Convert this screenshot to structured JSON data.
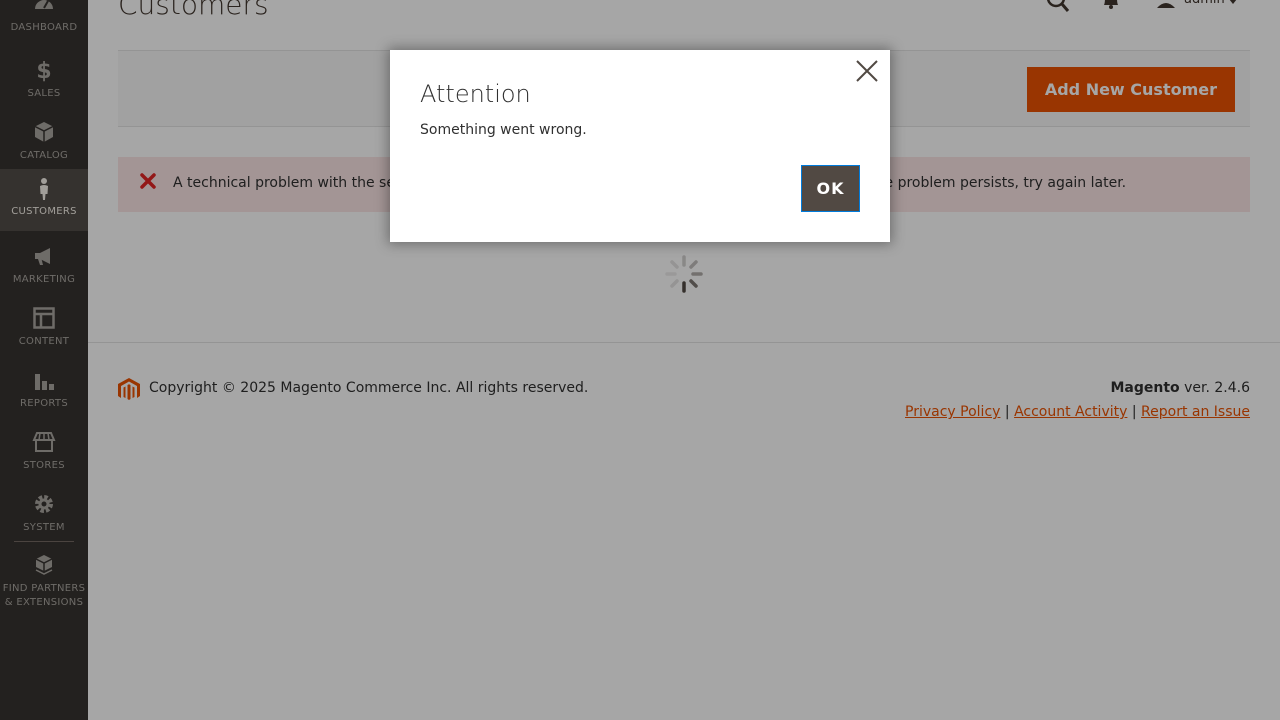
{
  "sidebar": {
    "items": [
      {
        "label": "Dashboard",
        "icon": "dashboard-icon"
      },
      {
        "label": "Sales",
        "icon": "dollar-icon"
      },
      {
        "label": "Catalog",
        "icon": "box-icon"
      },
      {
        "label": "Customers",
        "icon": "person-icon"
      },
      {
        "label": "Marketing",
        "icon": "megaphone-icon"
      },
      {
        "label": "Content",
        "icon": "layout-icon"
      },
      {
        "label": "Reports",
        "icon": "bar-chart-icon"
      },
      {
        "label": "Stores",
        "icon": "store-icon"
      },
      {
        "label": "System",
        "icon": "gear-icon"
      },
      {
        "label": "Find Partners & Extensions",
        "icon": "extensions-icon"
      }
    ],
    "active": "Customers"
  },
  "header": {
    "title": "Customers",
    "user": "admin"
  },
  "actions": {
    "add_label": "Add New Customer"
  },
  "message": {
    "type": "error",
    "text": "A technical problem with the server created an error. Try again to continue what you were doing. If the problem persists, try again later."
  },
  "footer": {
    "copyright": "Copyright © 2025 Magento Commerce Inc. All rights reserved.",
    "brand": "Magento",
    "version": "ver. 2.4.6",
    "links": [
      "Privacy Policy",
      "Account Activity",
      "Report an Issue"
    ]
  },
  "modal": {
    "title": "Attention",
    "body": "Something went wrong.",
    "ok_label": "OK"
  },
  "colors": {
    "accent": "#eb5202",
    "sidebar_bg": "#373330",
    "error_bg": "#fae5e5",
    "error_icon": "#e22626"
  }
}
